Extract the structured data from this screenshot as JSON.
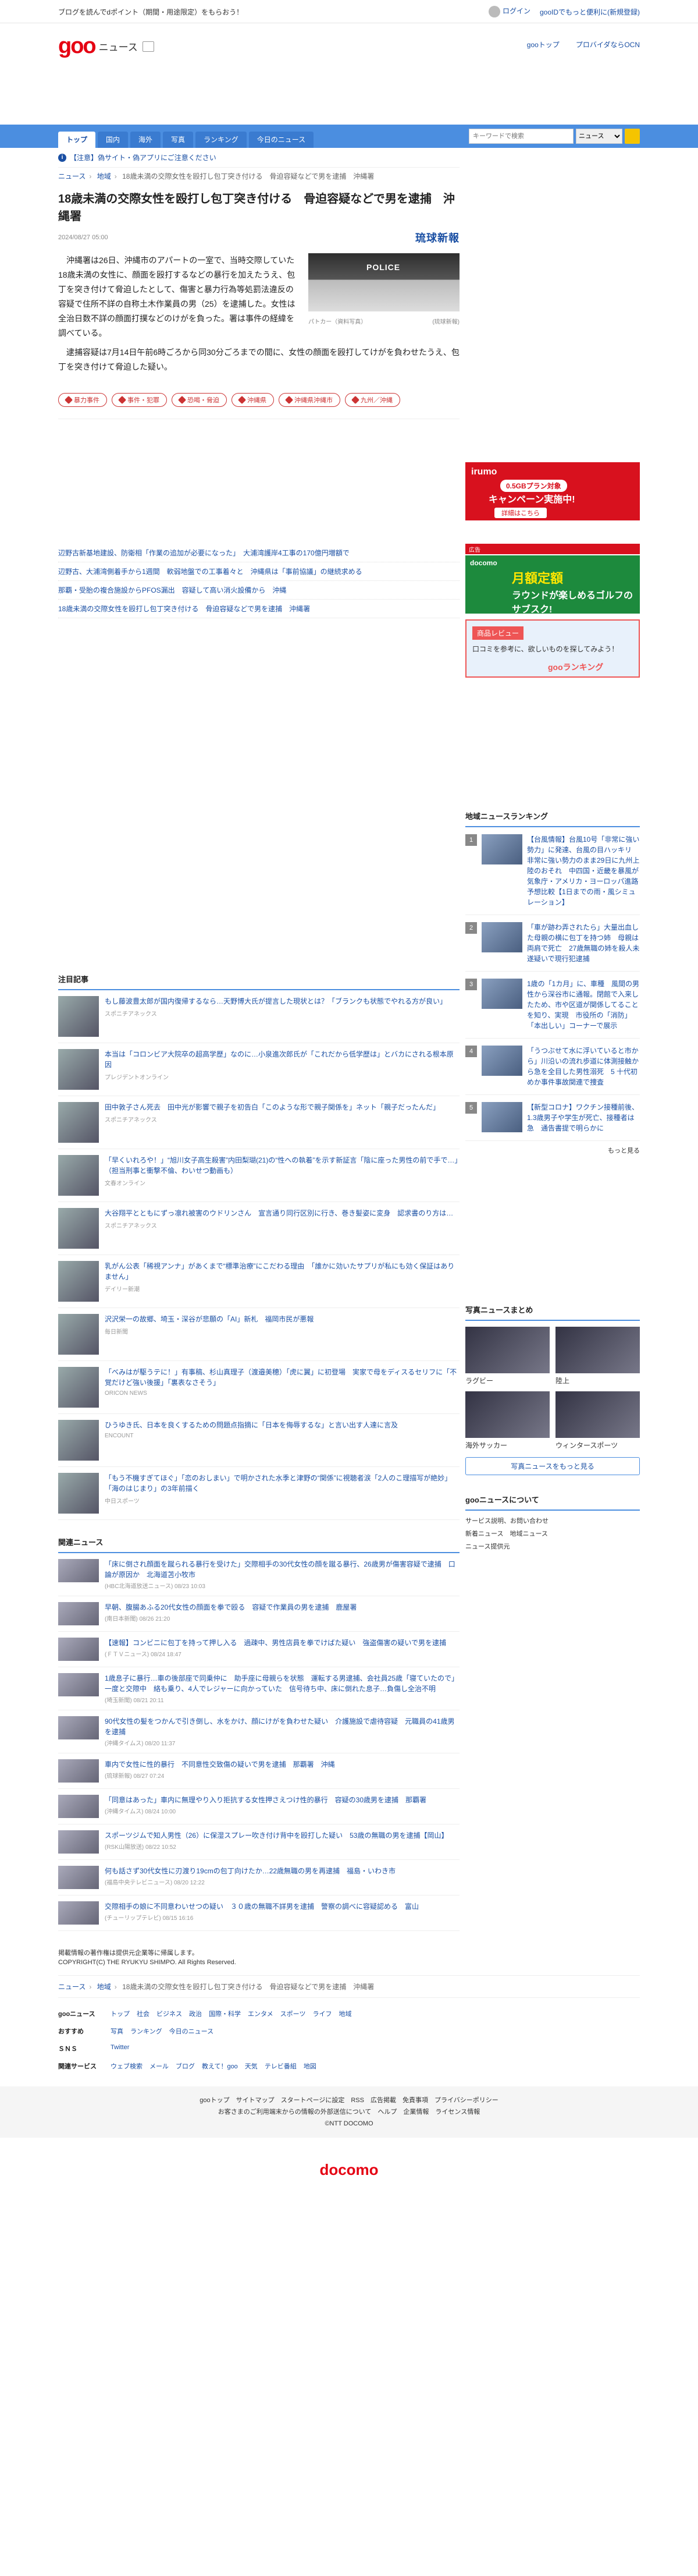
{
  "util": {
    "left": "ブログを読んでdポイント（期間・用途限定）をもらおう！",
    "login": "ログイン",
    "right_link": "gooIDでもっと便利に(新規登録)"
  },
  "header": {
    "logo": "goo",
    "logo_sub": "ニュース",
    "link1": "gooトップ",
    "link2": "プロバイダならOCN"
  },
  "nav": {
    "tabs": [
      "トップ",
      "国内",
      "海外",
      "写真",
      "ランキング",
      "今日のニュース"
    ],
    "search_placeholder": "キーワードで検索",
    "search_scope": "ニュース"
  },
  "notice": "【注意】偽サイト・偽アプリにご注意ください",
  "breadcrumbs": [
    "ニュース",
    "地域",
    "18歳未満の交際女性を殴打し包丁突き付ける　骨迫容疑などで男を逮捕　沖縄署"
  ],
  "article": {
    "title": "18歳未満の交際女性を殴打し包丁突き付ける　骨迫容疑などで男を逮捕　沖縄署",
    "date": "2024/08/27 05:00",
    "source": "琉球新報",
    "photo_text": "POLICE",
    "photo_caption": "パトカー（資料写真）",
    "photo_credit": "(琉球新報)",
    "p1": "沖縄署は26日、沖縄市のアパートの一室で、当時交際していた18歳未満の女性に、顔面を殴打するなどの暴行を加えたうえ、包丁を突き付けて脅迫したとして、傷害と暴力行為等処罰法違反の容疑で住所不詳の自称土木作業員の男（25）を逮捕した。女性は全治日数不詳の顔面打撲などのけがを負った。署は事件の経緯を調べている。",
    "p2": "逮捕容疑は7月14日午前6時ごろから同30分ごろまでの間に、女性の顔面を殴打してけがを負わせたうえ、包丁を突き付けて脅迫した疑い。"
  },
  "tags": [
    "暴力事件",
    "事件・犯罪",
    "恐喝・脅迫",
    "沖縄県",
    "沖縄県沖縄市",
    "九州／沖縄"
  ],
  "ads": {
    "irumo_l1": "irumo",
    "irumo_l2": "0.5GBプラン対象",
    "irumo_l3": "キャンペーン実施中!",
    "irumo_l4": "詳細はこちら",
    "golf_strip": "広告",
    "golf_brand": "docomo",
    "golf_main": "月額定額",
    "golf_sub": "ラウンドが楽しめるゴルフのサブスク!",
    "rank_a": "商品レビュー",
    "rank_b": "口コミを参考に、欲しいものを探してみよう！",
    "rank_c": "gooランキング"
  },
  "related_links": [
    "辺野古新基地建設、防衛相「作業の追加が必要になった」　大浦湾護岸4工事の170億円増額で",
    "辺野古、大浦湾側着手から1週間　軟弱地盤での工事着々と　沖縄県は「事前協議」の継続求める",
    "那覇・受胎の複合施設からPFOS漏出　容疑して高い消火設備から　沖縄",
    "18歳未満の交際女性を殴打し包丁突き付ける　骨迫容疑などで男を逮捕　沖縄署"
  ],
  "regional_ranking": {
    "heading": "地域ニュースランキング",
    "items": [
      {
        "num": "1",
        "text": "【台風情報】台風10号「非常に強い勢力」に発達、台風の目ハッキリ　非常に強い勢力のまま29日に九州上陸のおそれ　中四国・近畿を暴風が　気象庁・アメリカ・ヨーロッパ進路予想比較【1日までの雨・風シミュレーション】"
      },
      {
        "num": "2",
        "text": "「車が跡わ弄されたら」大量出血した母親の横に包丁を持つ姉　母親は両肩で死亡　27歳無職の姉を殺人未遂疑いで現行犯逮捕"
      },
      {
        "num": "3",
        "text": "1歳の「1カ月」に、車種　風間の男性から深谷市に通報。閉館で入来したため、市や区道が関係してることを知り、実現　市役所の「消防」「本出しい」コーナーで展示"
      },
      {
        "num": "4",
        "text": "「うつぶせて水に浮いていると市から」川沿いの流れ歩道に体測接触から急を全目した男性溺死　5 十代初めか事件事故関連で捜査"
      },
      {
        "num": "5",
        "text": "【新型コロナ】ワクチン接種前後、1.3歳男子や学生が死亡、接種者は急　通告書提で明らかに"
      }
    ],
    "more": "もっと見る"
  },
  "chumoku": {
    "heading": "注目記事",
    "items": [
      {
        "title": "もし藤波豊太郎が国内復帰するなら…天野博大氏が提言した現状とは？「ブランクも状態でやれる方が良い」",
        "src": "スポニチアネックス"
      },
      {
        "title": "本当は「コロンビア大院卒の超高学歴」なのに…小泉進次郎氏が「これだから低学歴は」とバカにされる根本原因",
        "src": "プレジデントオンライン"
      },
      {
        "title": "田中敦子さん死去　田中光が影響で親子を初告白「このような形で親子関係を」ネット「親子だったんだ」",
        "src": "スポニチアネックス"
      },
      {
        "title": "「早くいれろや！」“旭川女子高生殺害”内田梨瑚(21)の“性への執着”を示す新証言「陰に座った男性の前で手で…」（担当刑事と衝撃不倫、わいせつ動画も）",
        "src": "文春オンライン"
      },
      {
        "title": "大谷翔平とともにずっ凛れ被害のウドリンさん　宣言通り同行区別に行き、巻き髪姿に変身　認求書のり方は…",
        "src": "スポニチアネックス"
      },
      {
        "title": "乳がん公表「稀視アンナ」があくまで“標準治療”にこだわる理由　「誰かに効いたサプリが私にも効く保証はありません」",
        "src": "デイリー新潮"
      },
      {
        "title": "沢沢栄一の故郷、埼玉・深谷が悲願の「AI」新札　福岡市民が悪報",
        "src": "毎日新聞"
      },
      {
        "title": "「べみはが駆うテに！」有事稿、杉山真理子（渡邉美穂）「虎に翼」に初登場　実家で母をディスるセリフに「不覚だけど強い後援」「裏表なさそう」",
        "src": "ORICON NEWS"
      },
      {
        "title": "ひうゆき氏、日本を良くするための問題点指摘に「日本を侮辱するな」と言い出す人達に言及",
        "src": "ENCOUNT"
      },
      {
        "title": "「もう不機すぎてほぐ」「恋のおしまい」で明かされた水季と津野の“関係”に視聴者涙「2人のこ理描写が絶妙」「海のはじまり」の3年前描く",
        "src": "中日スポーツ"
      }
    ]
  },
  "related_news": {
    "heading": "関連ニュース",
    "items": [
      {
        "title": "「床に倒され顔面を蹴られる暴行を受けた」交際相手の30代女性の顔を蹴る暴行、26歳男が傷害容疑で逮捕　口論が原因か　北海道苫小牧市",
        "src": "(HBC北海道放送ニュース) 08/23 10:03"
      },
      {
        "title": "早朝、腹腸あふる20代女性の顔面を拳で殴る　容疑で作業員の男を逮捕　鹿屋署",
        "src": "(南日本新聞) 08/26 21:20"
      },
      {
        "title": "【速報】コンビニに包丁を持って押し入る　過疎中、男性店員を拳でけばた疑い　強盗傷害の疑いで男を逮捕",
        "src": "(ＦＴＶニュース) 08/24 18:47"
      },
      {
        "title": "1歳息子に暴行…車の後部座で同乗仲に　助手座に母親らを状態　運転する男逮捕、会社員25歳「寝ていたので」一度と交際中　絡も乗り、4人でレジャーに向かっていた　信号待ち中、床に倒れた息子…負傷し全治不明",
        "src": "(埼玉新聞) 08/21 20:11"
      },
      {
        "title": "90代女性の髪をつかんで引き倒し、水をかけ、顔にけがを負わせた疑い　介護施設で虐待容疑　元職員の41歳男を逮捕",
        "src": "(沖縄タイムス) 08/20 11:37"
      },
      {
        "title": "車内で女性に性的暴行　不同意性交致傷の疑いで男を逮捕　那覇署　沖縄",
        "src": "(琉球新報) 08/27 07:24"
      },
      {
        "title": "「同意はあった」車内に無理やり入り拒抗する女性押さえつけ性的暴行　容疑の30歳男を逮捕　那覇署",
        "src": "(沖縄タイムス) 08/24 10:00"
      },
      {
        "title": "スポーツジムで知人男性（26）に保湿スプレー吹き付け背中を殴打した疑い　53歳の無職の男を逮捕【岡山】",
        "src": "(RSK山陽放送) 08/22 10:52"
      },
      {
        "title": "何も話さず30代女性に刃渡り19cmの包丁向けたか…22歳無職の男を再逮捕　福島・いわき市",
        "src": "(福島中央テレビニュース) 08/20 12:22"
      },
      {
        "title": "交際相手の娘に不同意わいせつの疑い　３０歳の無職不詳男を逮捕　警察の調べに容疑認める　富山",
        "src": "(チューリップテレビ) 08/15 16:16"
      }
    ]
  },
  "photo_matome": {
    "heading": "写真ニュースまとめ",
    "cells": [
      "ラグビー",
      "陸上",
      "海外サッカー",
      "ウィンタースポーツ"
    ],
    "more": "写真ニュースをもっと見る"
  },
  "about": {
    "heading": "gooニュースについて",
    "items": [
      "サービス説明、お問い合わせ",
      "新着ニュース　地域ニュース",
      "ニュース提供元"
    ]
  },
  "footer": {
    "copy1": "掲載情報の著作権は提供元企業等に帰属します。",
    "copy2": "COPYRIGHT(C) THE RYUKYU SHIMPO. All Rights Reserved.",
    "crumbs": [
      "ニュース",
      "地域",
      "18歳未満の交際女性を殴打し包丁突き付ける　骨迫容疑などで男を逮捕　沖縄署"
    ],
    "rows": [
      {
        "h": "gooニュース",
        "v": [
          "トップ",
          "社会",
          "ビジネス",
          "政治",
          "国際・科学",
          "エンタメ",
          "スポーツ",
          "ライフ",
          "地域"
        ]
      },
      {
        "h": "おすすめ",
        "v": [
          "写真",
          "ランキング",
          "今日のニュース"
        ]
      },
      {
        "h": "ＳＮＳ",
        "v": [
          "Twitter"
        ]
      },
      {
        "h": "関連サービス",
        "v": [
          "ウェブ検索",
          "メール",
          "ブログ",
          "教えて！goo",
          "天気",
          "テレビ番組",
          "地図"
        ]
      }
    ],
    "bottom1": "gooトップ　サイトマップ　スタートページに設定　RSS　広告掲載　免責事項　プライバシーポリシー",
    "bottom2": "お客さまのご利用端末からの情報の外部送信について　ヘルプ　企業情報　ライセンス情報",
    "bottom3": "©NTT DOCOMO",
    "docomo": "docomo"
  }
}
